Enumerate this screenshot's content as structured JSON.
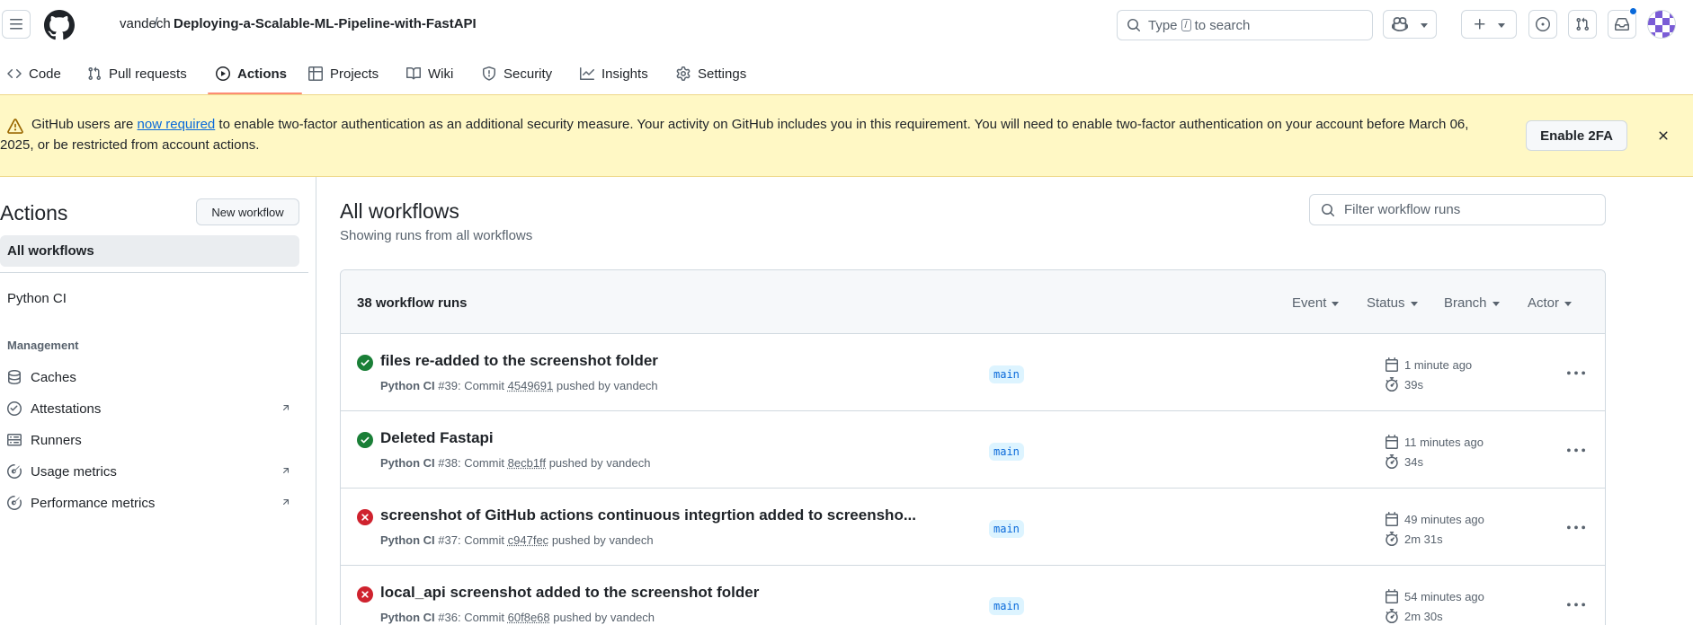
{
  "header": {
    "owner": "vandech",
    "separator": "/",
    "repo": "Deploying-a-Scalable-ML-Pipeline-with-FastAPI",
    "search_prefix": "Type",
    "search_key": "/",
    "search_suffix": "to search"
  },
  "nav": {
    "tabs": [
      {
        "label": "Code",
        "icon": "code-icon"
      },
      {
        "label": "Pull requests",
        "icon": "pull-request-icon"
      },
      {
        "label": "Actions",
        "icon": "play-icon"
      },
      {
        "label": "Projects",
        "icon": "table-icon"
      },
      {
        "label": "Wiki",
        "icon": "book-icon"
      },
      {
        "label": "Security",
        "icon": "shield-icon"
      },
      {
        "label": "Insights",
        "icon": "graph-icon"
      },
      {
        "label": "Settings",
        "icon": "gear-icon"
      }
    ],
    "selected": "Actions"
  },
  "banner": {
    "text_before": "GitHub users are ",
    "link": "now required",
    "text_after": " to enable two-factor authentication as an additional security measure. Your activity on GitHub includes you in this requirement. You will need to enable two-factor authentication on your account before March 06, 2025, or be restricted from account actions.",
    "button": "Enable 2FA"
  },
  "sidebar": {
    "title": "Actions",
    "new_workflow": "New workflow",
    "all_workflows": "All workflows",
    "workflows": [
      "Python CI"
    ],
    "management_heading": "Management",
    "management": [
      {
        "label": "Caches",
        "icon": "database-icon"
      },
      {
        "label": "Attestations",
        "icon": "verified-icon"
      },
      {
        "label": "Runners",
        "icon": "server-icon"
      },
      {
        "label": "Usage metrics",
        "icon": "meter-icon"
      },
      {
        "label": "Performance metrics",
        "icon": "meter-icon"
      }
    ]
  },
  "main": {
    "title": "All workflows",
    "subtitle": "Showing runs from all workflows",
    "filter_placeholder": "Filter workflow runs",
    "runs_count": "38 workflow runs",
    "filters": [
      "Event",
      "Status",
      "Branch",
      "Actor"
    ],
    "runs": [
      {
        "status": "success",
        "title": "files re-added to the screenshot folder",
        "workflow": "Python CI",
        "number": "#39",
        "sha": "4549691",
        "pusher": "vandech",
        "branch": "main",
        "when": "1 minute ago",
        "duration": "39s"
      },
      {
        "status": "success",
        "title": "Deleted Fastapi",
        "workflow": "Python CI",
        "number": "#38",
        "sha": "8ecb1ff",
        "pusher": "vandech",
        "branch": "main",
        "when": "11 minutes ago",
        "duration": "34s"
      },
      {
        "status": "failure",
        "title": "screenshot of GitHub actions continuous integrtion added to screensho...",
        "workflow": "Python CI",
        "number": "#37",
        "sha": "c947fec",
        "pusher": "vandech",
        "branch": "main",
        "when": "49 minutes ago",
        "duration": "2m 31s"
      },
      {
        "status": "failure",
        "title": "local_api screenshot added to the screenshot folder",
        "workflow": "Python CI",
        "number": "#36",
        "sha": "60f8e68",
        "pusher": "vandech",
        "branch": "main",
        "when": "54 minutes ago",
        "duration": "2m 30s"
      }
    ],
    "meta_commit": "Commit",
    "meta_pushed_by": "pushed by"
  },
  "colors": {
    "success": "#1a7f37",
    "failure": "#cf222e",
    "link": "#0969da",
    "banner_bg": "#fff8c5",
    "tab_underline": "#fd8c73"
  }
}
